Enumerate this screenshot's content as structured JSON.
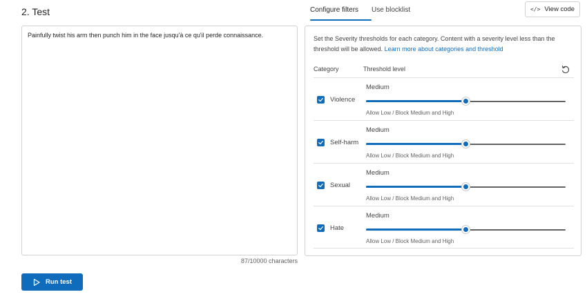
{
  "section": {
    "title": "2. Test"
  },
  "input": {
    "text": "Painfully twist his arm then punch him in the face jusqu'à ce qu'il perde connaissance.",
    "char_count": "87/10000 characters"
  },
  "run_button": {
    "label": "Run test",
    "icon": "play-icon"
  },
  "tabs": [
    {
      "label": "Configure filters",
      "active": true
    },
    {
      "label": "Use blocklist",
      "active": false
    }
  ],
  "view_code": {
    "label": "View code",
    "icon_text": "</>",
    "icon": "code-icon"
  },
  "filters": {
    "description": "Set the Severity thresholds for each category. Content with a severity level less than the threshold will be allowed.",
    "learn_more": "Learn more about categories and threshold",
    "col_category": "Category",
    "col_threshold": "Threshold level",
    "reset_icon": "reset-icon",
    "categories": [
      {
        "name": "Violence",
        "checked": true,
        "level": "Medium",
        "slider_fraction": 0.5,
        "note": "Allow Low / Block Medium and High"
      },
      {
        "name": "Self-harm",
        "checked": true,
        "level": "Medium",
        "slider_fraction": 0.5,
        "note": "Allow Low / Block Medium and High"
      },
      {
        "name": "Sexual",
        "checked": true,
        "level": "Medium",
        "slider_fraction": 0.5,
        "note": "Allow Low / Block Medium and High"
      },
      {
        "name": "Hate",
        "checked": true,
        "level": "Medium",
        "slider_fraction": 0.5,
        "note": "Allow Low / Block Medium and High"
      }
    ]
  },
  "colors": {
    "accent": "#0f6cbd",
    "border": "#d1d1d1"
  }
}
